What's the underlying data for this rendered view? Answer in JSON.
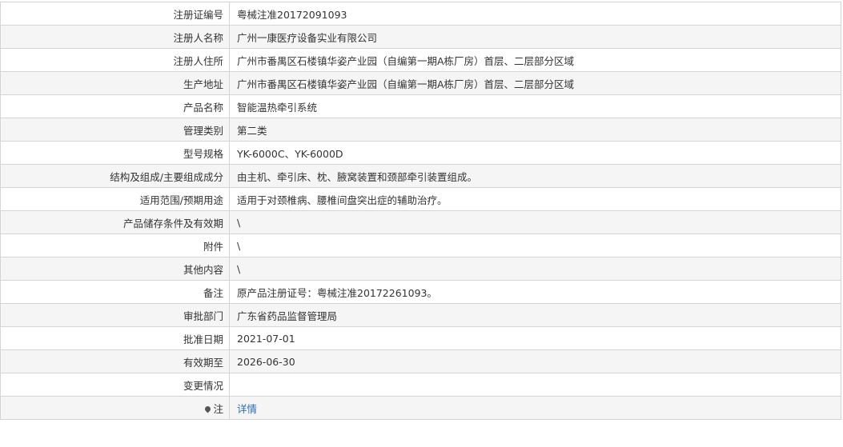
{
  "rows": [
    {
      "label": "注册证编号",
      "value": "粤械注准20172091093"
    },
    {
      "label": "注册人名称",
      "value": "广州一康医疗设备实业有限公司"
    },
    {
      "label": "注册人住所",
      "value": "广州市番禺区石楼镇华姿产业园（自编第一期A栋厂房）首层、二层部分区域"
    },
    {
      "label": "生产地址",
      "value": "广州市番禺区石楼镇华姿产业园（自编第一期A栋厂房）首层、二层部分区域"
    },
    {
      "label": "产品名称",
      "value": "智能温热牵引系统"
    },
    {
      "label": "管理类别",
      "value": "第二类"
    },
    {
      "label": "型号规格",
      "value": "YK-6000C、YK-6000D"
    },
    {
      "label": "结构及组成/主要组成成分",
      "value": "由主机、牵引床、枕、腋窝装置和颈部牵引装置组成。"
    },
    {
      "label": "适用范围/预期用途",
      "value": "适用于对颈椎病、腰椎间盘突出症的辅助治疗。"
    },
    {
      "label": "产品储存条件及有效期",
      "value": "\\"
    },
    {
      "label": "附件",
      "value": "\\"
    },
    {
      "label": "其他内容",
      "value": "\\"
    },
    {
      "label": "备注",
      "value": "原产品注册证号：粤械注准20172261093。"
    },
    {
      "label": "审批部门",
      "value": "广东省药品监督管理局"
    },
    {
      "label": "批准日期",
      "value": "2021-07-01"
    },
    {
      "label": "有效期至",
      "value": "2026-06-30"
    },
    {
      "label": "变更情况",
      "value": ""
    }
  ],
  "note_row": {
    "icon": "lightbulb-icon",
    "label": "注",
    "link_label": "详情"
  },
  "colors": {
    "row_alt_bg": "#f5f5f5",
    "border": "#d4d4d4",
    "link": "#2a6eb5"
  }
}
